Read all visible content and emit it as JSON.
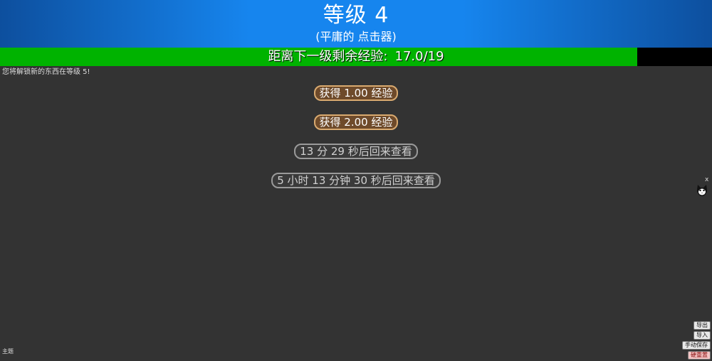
{
  "header": {
    "level_title": "等级 4",
    "subtitle": "(平庸的 点击器)"
  },
  "xp_bar": {
    "label": "距离下一级剩余经验:",
    "value_text": "17.0/19",
    "current": 17.0,
    "max": 19,
    "fill_color": "#00b300",
    "track_color": "#000000"
  },
  "unlock_note": "您将解锁新的东西在等级 5!",
  "buttons": [
    {
      "label": "获得 1.00 经验",
      "state": "active"
    },
    {
      "label": "获得 2.00 经验",
      "state": "active"
    },
    {
      "label": "13 分 29 秒后回来查看",
      "state": "cooldown"
    },
    {
      "label": "5 小时 13 分钟 30 秒后回来查看",
      "state": "cooldown"
    }
  ],
  "mascot": {
    "icon": "cat-face-icon",
    "close_label": "x"
  },
  "footer": {
    "theme_label": "主题",
    "export_label": "导出",
    "import_label": "导入",
    "manual_save_label": "手动保存",
    "hard_reset_label": "硬重置"
  },
  "colors": {
    "background": "#333333",
    "header_blue": "#1685ee",
    "button_border_active": "#d9aa70",
    "button_border_wait": "#9a9a9a"
  }
}
